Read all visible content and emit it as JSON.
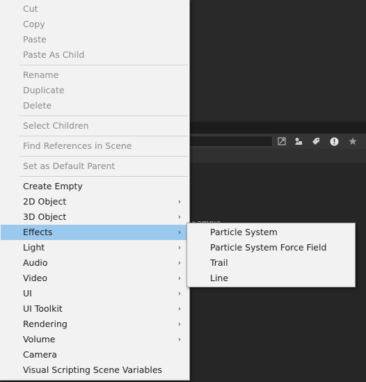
{
  "background": {
    "toolbar_icons": [
      "scene-visibility-icon",
      "audio-icon",
      "tag-icon",
      "warning-icon",
      "star-icon"
    ],
    "peek_text": "Sample"
  },
  "menu": {
    "items": [
      {
        "label": "Cut",
        "disabled": true
      },
      {
        "label": "Copy",
        "disabled": true
      },
      {
        "label": "Paste",
        "disabled": true
      },
      {
        "label": "Paste As Child",
        "disabled": true
      },
      {
        "label": "Rename",
        "disabled": true
      },
      {
        "label": "Duplicate",
        "disabled": true
      },
      {
        "label": "Delete",
        "disabled": true
      },
      {
        "label": "Select Children",
        "disabled": true
      },
      {
        "label": "Find References in Scene",
        "disabled": true
      },
      {
        "label": "Set as Default Parent",
        "disabled": true
      },
      {
        "label": "Create Empty",
        "disabled": false
      },
      {
        "label": "2D Object",
        "disabled": false,
        "submenu": true
      },
      {
        "label": "3D Object",
        "disabled": false,
        "submenu": true
      },
      {
        "label": "Effects",
        "disabled": false,
        "submenu": true,
        "active": true
      },
      {
        "label": "Light",
        "disabled": false,
        "submenu": true
      },
      {
        "label": "Audio",
        "disabled": false,
        "submenu": true
      },
      {
        "label": "Video",
        "disabled": false,
        "submenu": true
      },
      {
        "label": "UI",
        "disabled": false,
        "submenu": true
      },
      {
        "label": "UI Toolkit",
        "disabled": false,
        "submenu": true
      },
      {
        "label": "Rendering",
        "disabled": false,
        "submenu": true
      },
      {
        "label": "Volume",
        "disabled": false,
        "submenu": true
      },
      {
        "label": "Camera",
        "disabled": false
      },
      {
        "label": "Visual Scripting Scene Variables",
        "disabled": false
      }
    ],
    "arrow_glyph": "›"
  },
  "submenu": {
    "items": [
      {
        "label": "Particle System"
      },
      {
        "label": "Particle System Force Field"
      },
      {
        "label": "Trail"
      },
      {
        "label": "Line"
      }
    ]
  },
  "colors": {
    "menu_background": "#f2f2f2",
    "highlight": "#99c9ef",
    "disabled_text": "#8a8a8a",
    "editor_background": "#262626"
  }
}
